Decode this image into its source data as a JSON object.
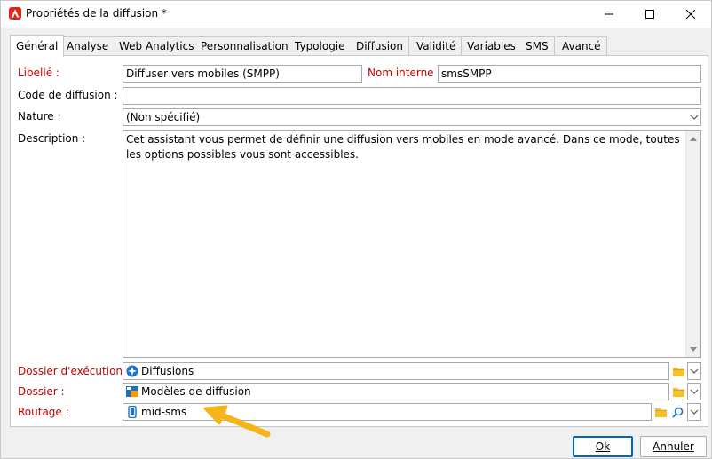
{
  "window": {
    "title": "Propriétés de la diffusion *"
  },
  "tabs": [
    {
      "label": "Général"
    },
    {
      "label": "Analyse"
    },
    {
      "label": "Web Analytics"
    },
    {
      "label": "Personnalisation"
    },
    {
      "label": "Typologie"
    },
    {
      "label": "Diffusion"
    },
    {
      "label": "Validité"
    },
    {
      "label": "Variables"
    },
    {
      "label": "SMS"
    },
    {
      "label": "Avancé"
    }
  ],
  "form": {
    "libelle_label": "Libellé :",
    "libelle_value": "Diffuser vers mobiles (SMPP)",
    "nom_interne_label": "Nom interne :",
    "nom_interne_value": "smsSMPP",
    "code_label": "Code de diffusion :",
    "code_value": "",
    "nature_label": "Nature :",
    "nature_value": "(Non spécifié)",
    "description_label": "Description :",
    "description_value": "Cet assistant vous permet de définir une diffusion vers mobiles en mode avancé. Dans ce mode, toutes les options possibles vous sont accessibles.",
    "dossier_exec_label": "Dossier d'exécution :",
    "dossier_exec_value": "Diffusions",
    "dossier_label": "Dossier :",
    "dossier_value": "Modèles de diffusion",
    "routage_label": "Routage :",
    "routage_value": "mid-sms"
  },
  "buttons": {
    "ok": "Ok",
    "cancel": "Annuler"
  },
  "colors": {
    "required_label": "#c00000",
    "accent": "#0067c0",
    "arrow": "#f5b418"
  },
  "icons": {
    "app": "adobe-icon",
    "folder": "folder-icon",
    "search": "magnifier-icon",
    "dropdown": "chevron-down-icon"
  }
}
